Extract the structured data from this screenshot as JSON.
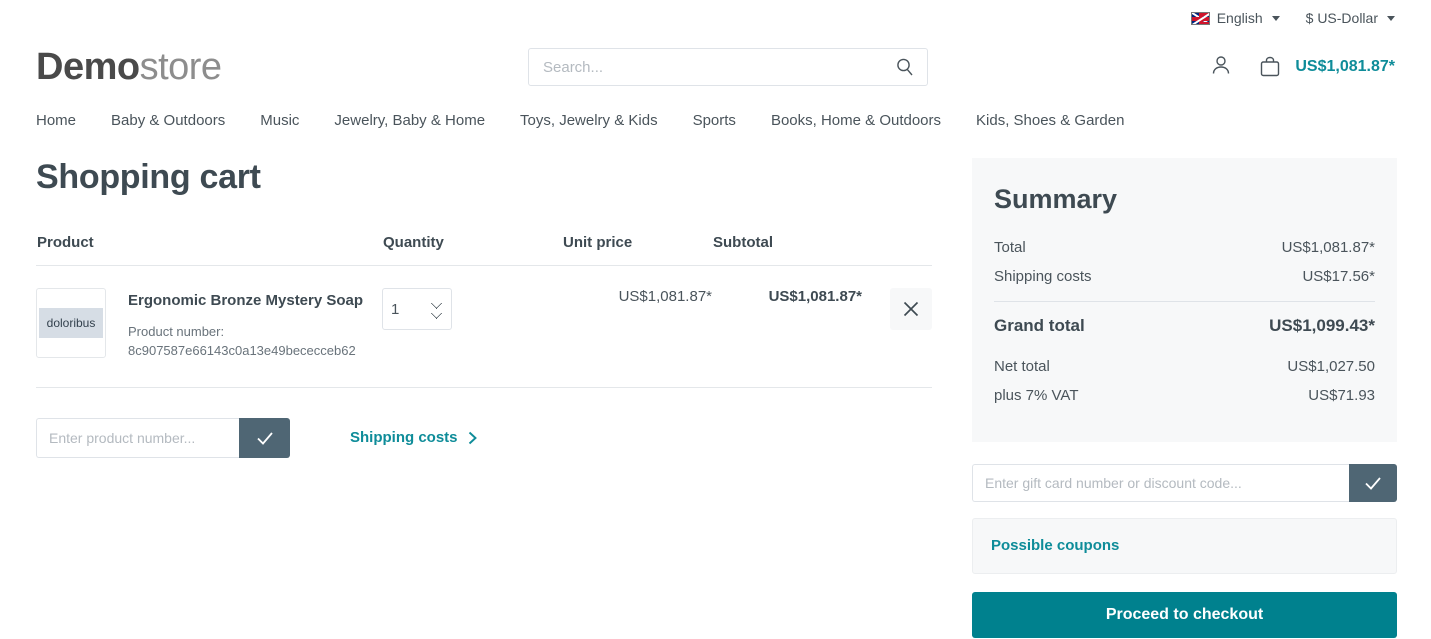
{
  "topbar": {
    "language": "English",
    "currency": "$ US-Dollar",
    "flag_icon": "uk-flag-icon"
  },
  "header": {
    "logo_bold": "Demo",
    "logo_light": "store",
    "search_placeholder": "Search...",
    "search_value": "",
    "cart_total": "US$1,081.87*"
  },
  "nav": {
    "items": [
      {
        "label": "Home"
      },
      {
        "label": "Baby & Outdoors"
      },
      {
        "label": "Music"
      },
      {
        "label": "Jewelry, Baby & Home"
      },
      {
        "label": "Toys, Jewelry & Kids"
      },
      {
        "label": "Sports"
      },
      {
        "label": "Books, Home & Outdoors"
      },
      {
        "label": "Kids, Shoes & Garden"
      }
    ]
  },
  "cart": {
    "title": "Shopping cart",
    "columns": {
      "product": "Product",
      "quantity": "Quantity",
      "unit_price": "Unit price",
      "subtotal": "Subtotal"
    },
    "items": [
      {
        "thumb_text": "doloribus",
        "name": "Ergonomic Bronze Mystery Soap",
        "product_number_label": "Product number:",
        "product_number": "8c907587e66143c0a13e49bececceb62",
        "quantity": "1",
        "unit_price": "US$1,081.87*",
        "subtotal": "US$1,081.87*"
      }
    ],
    "product_number_placeholder": "Enter product number...",
    "product_number_value": "",
    "shipping_costs_link": "Shipping costs"
  },
  "summary": {
    "title": "Summary",
    "rows": [
      {
        "label": "Total",
        "value": "US$1,081.87*"
      },
      {
        "label": "Shipping costs",
        "value": "US$17.56*"
      }
    ],
    "grand_total": {
      "label": "Grand total",
      "value": "US$1,099.43*"
    },
    "after_rows": [
      {
        "label": "Net total",
        "value": "US$1,027.50"
      },
      {
        "label": "plus 7% VAT",
        "value": "US$71.93"
      }
    ],
    "gift_placeholder": "Enter gift card number or discount code...",
    "gift_value": "",
    "possible_coupons": "Possible coupons",
    "checkout_label": "Proceed to checkout"
  },
  "colors": {
    "accent_teal": "#0e8c99",
    "button_teal": "#00818e",
    "slate": "#4f6674"
  }
}
